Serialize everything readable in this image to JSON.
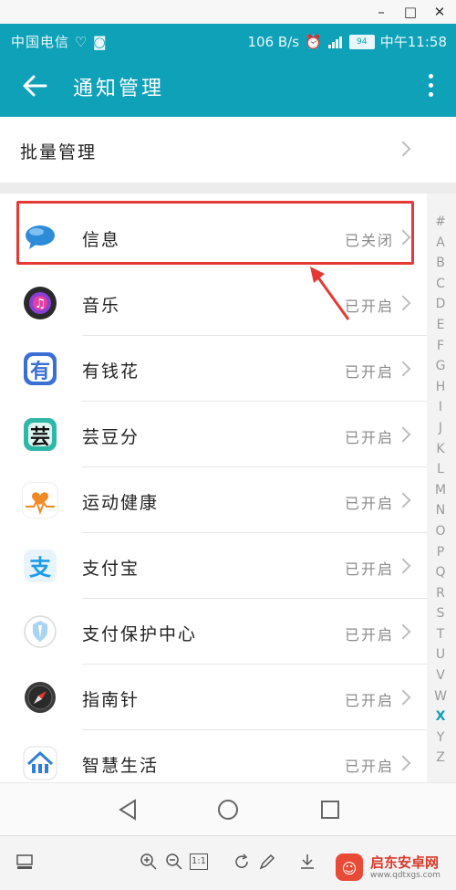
{
  "window": {
    "minimize": "–",
    "maximize": "□",
    "close": "✕"
  },
  "status_bar": {
    "carrier": "中国电信",
    "speed": "106 B/s",
    "battery": "94",
    "time": "中午11:58"
  },
  "app_bar": {
    "title": "通知管理"
  },
  "batch": {
    "label": "批量管理"
  },
  "apps": [
    {
      "name": "信息",
      "state": "已关闭",
      "icon": "message-icon",
      "color": "#2e8bd8"
    },
    {
      "name": "音乐",
      "state": "已开启",
      "icon": "music-icon",
      "color": "#333333"
    },
    {
      "name": "有钱花",
      "state": "已开启",
      "icon": "youqianhua-icon",
      "color": "#3a6fd6"
    },
    {
      "name": "芸豆分",
      "state": "已开启",
      "icon": "yundoufen-icon",
      "color": "#2fb7a8"
    },
    {
      "name": "运动健康",
      "state": "已开启",
      "icon": "health-icon",
      "color": "#f08a24"
    },
    {
      "name": "支付宝",
      "state": "已开启",
      "icon": "alipay-icon",
      "color": "#1e9be8"
    },
    {
      "name": "支付保护中心",
      "state": "已开启",
      "icon": "payment-protect-icon",
      "color": "#7fb9e6"
    },
    {
      "name": "指南针",
      "state": "已开启",
      "icon": "compass-icon",
      "color": "#3a3a3a"
    },
    {
      "name": "智慧生活",
      "state": "已开启",
      "icon": "smart-life-icon",
      "color": "#2f7fd6"
    }
  ],
  "index_letters": [
    "#",
    "A",
    "B",
    "C",
    "D",
    "E",
    "F",
    "G",
    "H",
    "I",
    "J",
    "K",
    "L",
    "M",
    "N",
    "O",
    "P",
    "Q",
    "R",
    "S",
    "T",
    "U",
    "V",
    "W",
    "X",
    "Y",
    "Z"
  ],
  "index_active": "X",
  "toolbar": {
    "page_ratio": "1:1"
  },
  "watermark": {
    "text": "启东安卓网",
    "url": "www.qdtxgs.com"
  },
  "colors": {
    "accent": "#0fa1b8",
    "highlight": "#e53935"
  }
}
